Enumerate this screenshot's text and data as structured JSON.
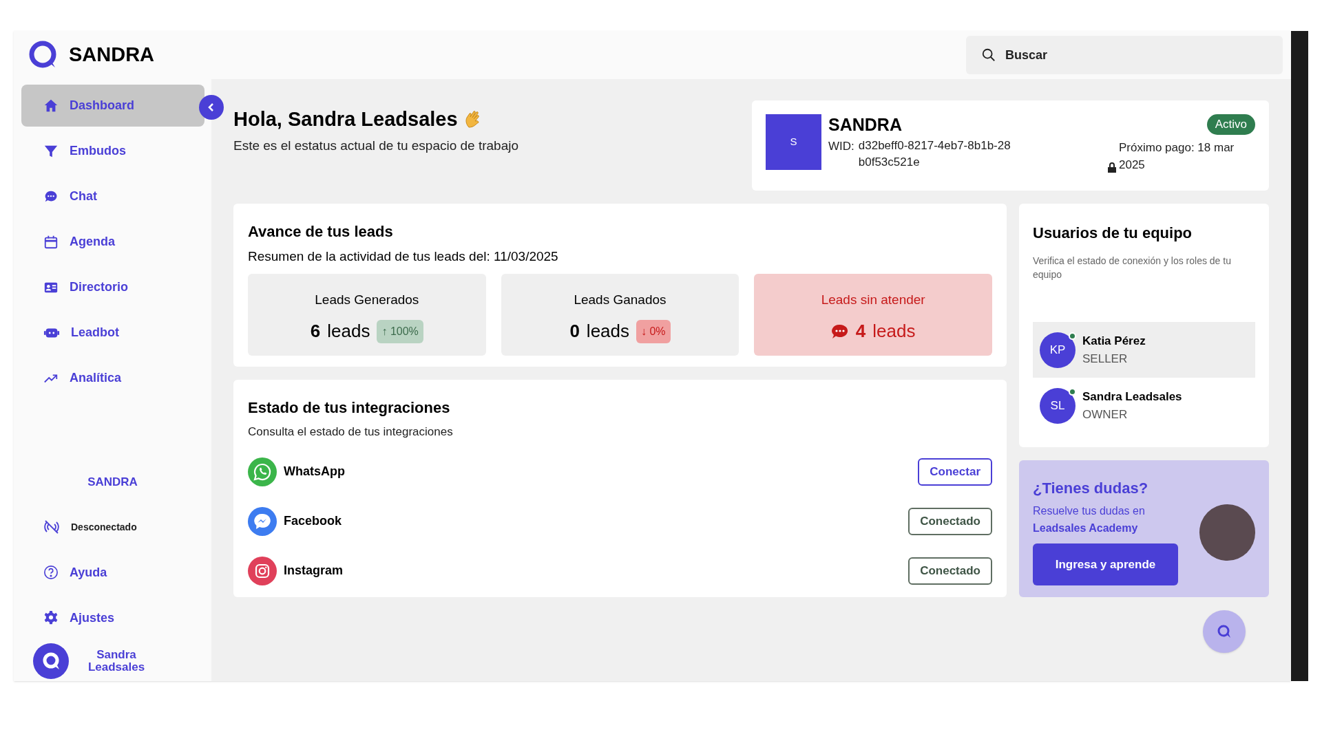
{
  "brand": {
    "name": "SANDRA"
  },
  "search": {
    "placeholder": "Buscar"
  },
  "nav": [
    {
      "label": "Dashboard",
      "selected": true
    },
    {
      "label": "Embudos",
      "selected": false
    },
    {
      "label": "Chat",
      "selected": false
    },
    {
      "label": "Agenda",
      "selected": false
    },
    {
      "label": "Directorio",
      "selected": false
    },
    {
      "label": "Leadbot",
      "selected": false
    },
    {
      "label": "Analítica",
      "selected": false
    }
  ],
  "workspace_label": "SANDRA",
  "sidebar_bottom": [
    {
      "label": "Desconectado",
      "kind": "status"
    },
    {
      "label": "Ayuda",
      "kind": "help"
    },
    {
      "label": "Ajustes",
      "kind": "settings"
    }
  ],
  "user": {
    "name": "Sandra Leadsales"
  },
  "greeting": {
    "title": "Hola, Sandra Leadsales",
    "subtitle": "Este es el estatus actual de tu espacio de trabajo"
  },
  "workspace": {
    "avatar": "S",
    "name": "SANDRA",
    "wid_label": "WID:",
    "wid": "d32beff0-8217-4eb7-8b1b-28b0f53c521e",
    "status": "Activo",
    "next_payment": "Próximo pago: 18 mar 2025"
  },
  "leads": {
    "title": "Avance de tus leads",
    "subtitle": "Resumen de la actividad de tus leads del: 11/03/2025",
    "stats": [
      {
        "kind": "up",
        "label": "Leads Generados",
        "value": "6",
        "unit": "leads",
        "change": "↑ 100%"
      },
      {
        "kind": "down",
        "label": "Leads Ganados",
        "value": "0",
        "unit": "leads",
        "change": "↓ 0%"
      },
      {
        "kind": "alert",
        "label": "Leads sin atender",
        "value": "4",
        "unit": "leads"
      }
    ]
  },
  "integrations": {
    "title": "Estado de tus integraciones",
    "subtitle": "Consulta el estado de tus integraciones",
    "items": [
      {
        "kind": "whatsapp",
        "name": "WhatsApp",
        "action": "Conectar",
        "connected": false
      },
      {
        "kind": "messenger",
        "name": "Facebook",
        "action": "Conectado",
        "connected": true
      },
      {
        "kind": "instagram",
        "name": "Instagram",
        "action": "Conectado",
        "connected": true
      }
    ]
  },
  "team": {
    "title": "Usuarios de tu equipo",
    "subtitle": "Verifica el estado de conexión y los roles de tu equipo",
    "members": [
      {
        "initials": "KP",
        "name": "Katia Pérez",
        "role": "SELLER",
        "online": true,
        "selected": true
      },
      {
        "initials": "SL",
        "name": "Sandra Leadsales",
        "role": "OWNER",
        "online": true,
        "selected": false
      }
    ]
  },
  "help": {
    "title": "¿Tienes dudas?",
    "text": "Resuelve tus dudas en **Leadsales Academy**",
    "button": "Ingresa y aprende"
  }
}
